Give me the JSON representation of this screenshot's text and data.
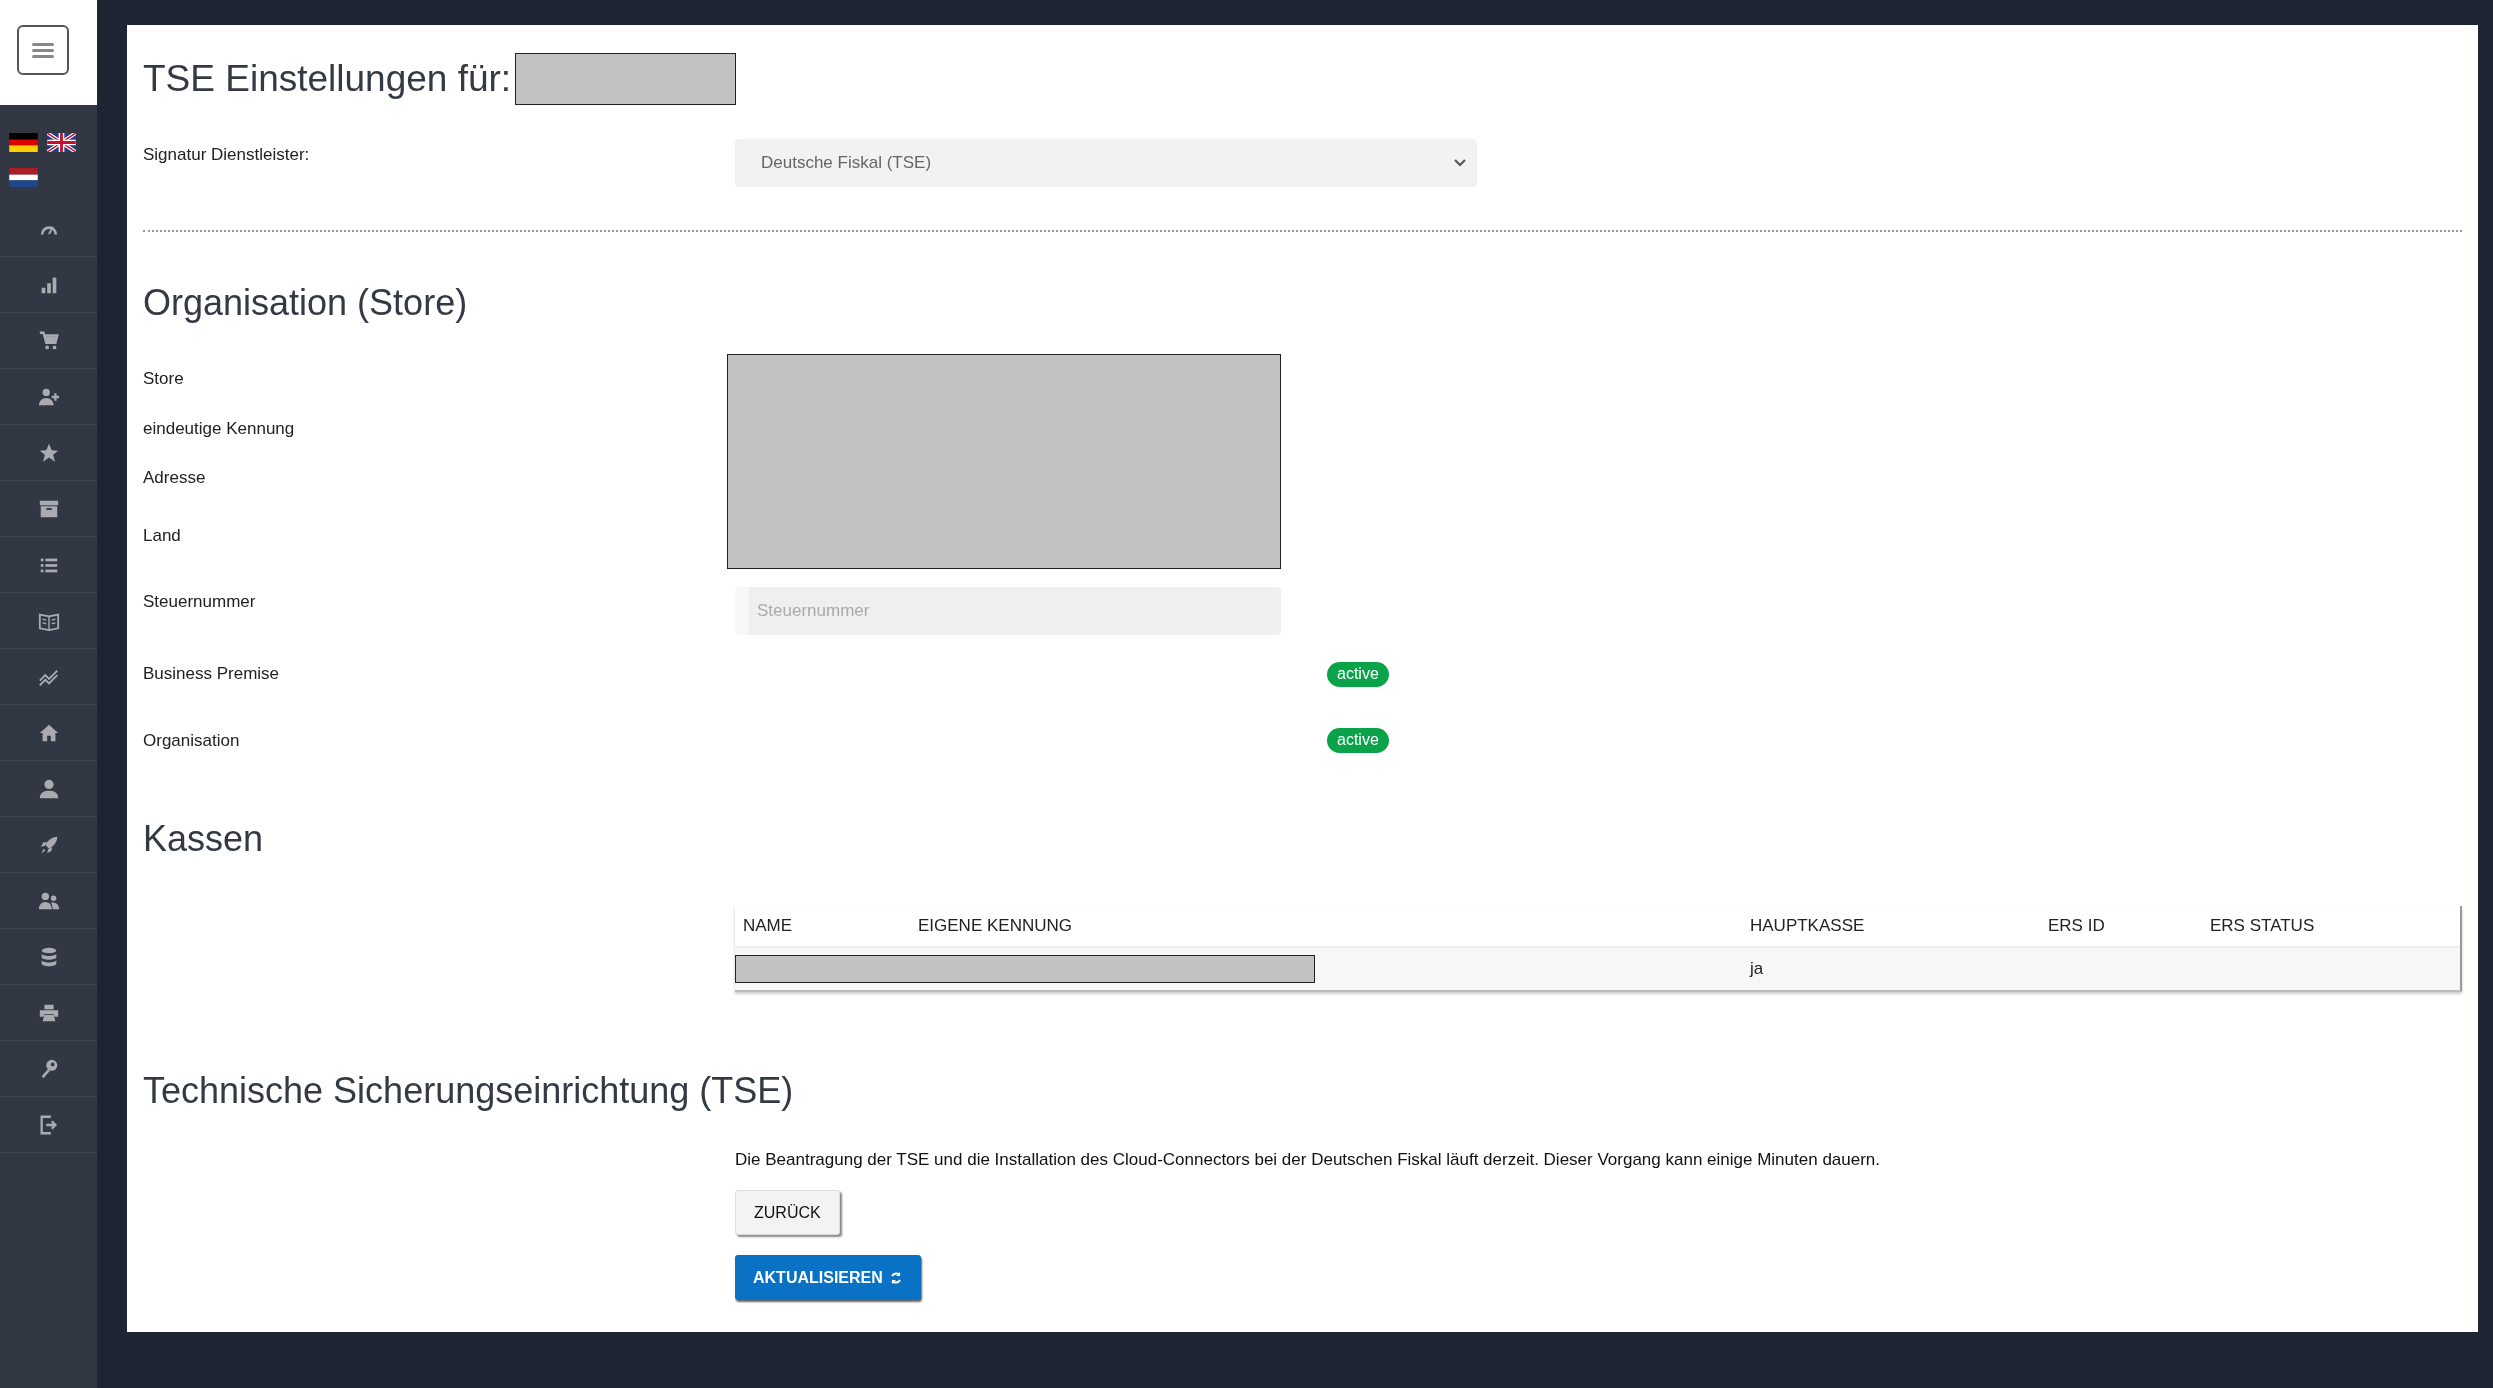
{
  "page_title": "TSE Einstellungen für:",
  "provider": {
    "label": "Signatur Dienstleister:",
    "value": "Deutsche Fiskal (TSE)"
  },
  "organisation": {
    "heading": "Organisation (Store)",
    "fields": [
      {
        "label": "Store"
      },
      {
        "label": "eindeutige Kennung"
      },
      {
        "label": "Adresse"
      },
      {
        "label": "Land"
      }
    ],
    "tax": {
      "label": "Steuernummer",
      "placeholder": "Steuernummer"
    },
    "statuses": [
      {
        "label": "Business Premise",
        "status": "active"
      },
      {
        "label": "Organisation",
        "status": "active"
      }
    ]
  },
  "registers": {
    "heading": "Kassen",
    "columns": [
      "NAME",
      "EIGENE KENNUNG",
      "HAUPTKASSE",
      "ERS ID",
      "ERS STATUS"
    ],
    "rows": [
      {
        "hauptkasse": "ja"
      }
    ]
  },
  "tse": {
    "heading": "Technische Sicherungseinrichtung (TSE)",
    "message": "Die Beantragung der TSE und die Installation des Cloud-Connectors bei der Deutschen Fiskal läuft derzeit. Dieser Vorgang kann einige Minuten dauern.",
    "back_button": "ZURÜCK",
    "refresh_button": "AKTUALISIEREN"
  }
}
